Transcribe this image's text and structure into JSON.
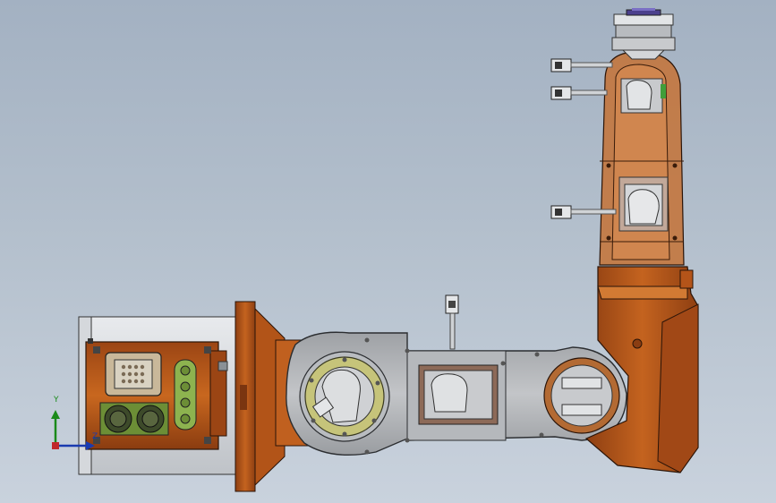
{
  "scene": {
    "background_top": "#a3b1c2",
    "background_bottom": "#c9d2dd",
    "robot_color": "#b1561c",
    "arm_color": "#b0b2b6",
    "flange_color": "#c6c47a"
  },
  "triad": {
    "y_label": "Y",
    "z_label": "Z",
    "x_color": "#c0282a",
    "y_color": "#1a8a1a",
    "z_color": "#1a3bb0"
  }
}
